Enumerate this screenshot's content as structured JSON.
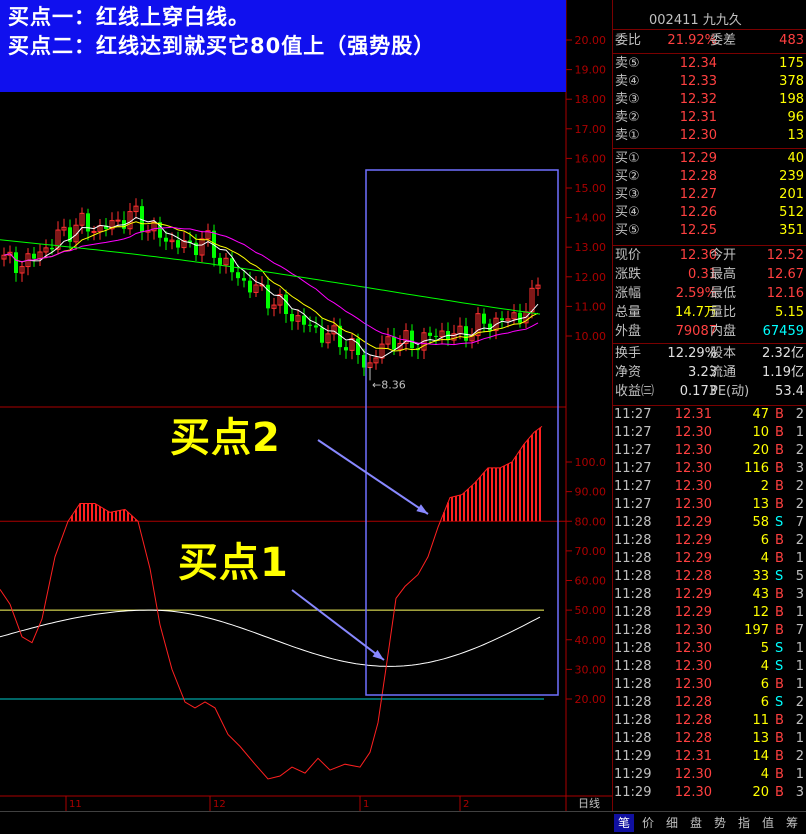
{
  "banner": {
    "line1": "买点一：红线上穿白线。",
    "line2": "买点二：红线达到就买它80值上（强势股）"
  },
  "callouts": {
    "buy2": "买点2",
    "buy1": "买点1"
  },
  "chart": {
    "low_marker": "8.36",
    "x_labels": [
      "11",
      "12",
      "1",
      "2"
    ],
    "period_label": "日线",
    "price_ticks": [
      "20.00",
      "19.00",
      "18.00",
      "17.00",
      "16.00",
      "15.00",
      "14.00",
      "13.00",
      "12.00",
      "11.00",
      "10.00"
    ],
    "ind_ticks": [
      "100.0",
      "90.00",
      "80.00",
      "70.00",
      "60.00",
      "50.00",
      "40.00",
      "30.00",
      "20.00"
    ],
    "colors": {
      "up": "#ff3030",
      "down": "#00ff00",
      "ma5": "#ffffff",
      "ma10": "#ffff00",
      "ma20": "#ff00ff",
      "ma60": "#00ff00",
      "axis": "#aa0000",
      "box": "#7070ff"
    }
  },
  "quote": {
    "stock_code": "002411",
    "stock_name": "九九久",
    "weibi_label": "委比",
    "weibi_value": "21.92%",
    "weicha_label": "委差",
    "weicha_value": "483",
    "asks": [
      {
        "label": "卖⑤",
        "price": "12.34",
        "vol": "175"
      },
      {
        "label": "卖④",
        "price": "12.33",
        "vol": "378"
      },
      {
        "label": "卖③",
        "price": "12.32",
        "vol": "198"
      },
      {
        "label": "卖②",
        "price": "12.31",
        "vol": "96"
      },
      {
        "label": "卖①",
        "price": "12.30",
        "vol": "13"
      }
    ],
    "bids": [
      {
        "label": "买①",
        "price": "12.29",
        "vol": "40"
      },
      {
        "label": "买②",
        "price": "12.28",
        "vol": "239"
      },
      {
        "label": "买③",
        "price": "12.27",
        "vol": "201"
      },
      {
        "label": "买④",
        "price": "12.26",
        "vol": "512"
      },
      {
        "label": "买⑤",
        "price": "12.25",
        "vol": "351"
      }
    ],
    "stats": [
      {
        "l1": "现价",
        "v1": "12.30",
        "l2": "今开",
        "v2": "12.52"
      },
      {
        "l1": "涨跌",
        "v1": "0.31",
        "l2": "最高",
        "v2": "12.67"
      },
      {
        "l1": "涨幅",
        "v1": "2.59%",
        "l2": "最低",
        "v2": "12.16"
      },
      {
        "l1": "总量",
        "v1": "14.7万",
        "l2": "量比",
        "v2": "5.15"
      },
      {
        "l1": "外盘",
        "v1": "79087",
        "l2": "内盘",
        "v2": "67459"
      }
    ],
    "stats2": [
      {
        "l1": "换手",
        "v1": "12.29%",
        "l2": "股本",
        "v2": "2.32亿"
      },
      {
        "l1": "净资",
        "v1": "3.23",
        "l2": "流通",
        "v2": "1.19亿"
      },
      {
        "l1": "收益㈢",
        "v1": "0.173",
        "l2": "PE(动)",
        "v2": "53.4"
      }
    ]
  },
  "ticks": [
    {
      "t": "11:27",
      "p": "12.31",
      "v": "47",
      "s": "B",
      "n": "2"
    },
    {
      "t": "11:27",
      "p": "12.30",
      "v": "10",
      "s": "B",
      "n": "1"
    },
    {
      "t": "11:27",
      "p": "12.30",
      "v": "20",
      "s": "B",
      "n": "2"
    },
    {
      "t": "11:27",
      "p": "12.30",
      "v": "116",
      "s": "B",
      "n": "3"
    },
    {
      "t": "11:27",
      "p": "12.30",
      "v": "2",
      "s": "B",
      "n": "2"
    },
    {
      "t": "11:27",
      "p": "12.30",
      "v": "13",
      "s": "B",
      "n": "2"
    },
    {
      "t": "11:28",
      "p": "12.29",
      "v": "58",
      "s": "S",
      "n": "7"
    },
    {
      "t": "11:28",
      "p": "12.29",
      "v": "6",
      "s": "B",
      "n": "2"
    },
    {
      "t": "11:28",
      "p": "12.29",
      "v": "4",
      "s": "B",
      "n": "1"
    },
    {
      "t": "11:28",
      "p": "12.28",
      "v": "33",
      "s": "S",
      "n": "5"
    },
    {
      "t": "11:28",
      "p": "12.29",
      "v": "43",
      "s": "B",
      "n": "3"
    },
    {
      "t": "11:28",
      "p": "12.29",
      "v": "12",
      "s": "B",
      "n": "1"
    },
    {
      "t": "11:28",
      "p": "12.30",
      "v": "197",
      "s": "B",
      "n": "7"
    },
    {
      "t": "11:28",
      "p": "12.30",
      "v": "5",
      "s": "S",
      "n": "1"
    },
    {
      "t": "11:28",
      "p": "12.30",
      "v": "4",
      "s": "S",
      "n": "1"
    },
    {
      "t": "11:28",
      "p": "12.30",
      "v": "6",
      "s": "B",
      "n": "1"
    },
    {
      "t": "11:28",
      "p": "12.28",
      "v": "6",
      "s": "S",
      "n": "2"
    },
    {
      "t": "11:28",
      "p": "12.28",
      "v": "11",
      "s": "B",
      "n": "2"
    },
    {
      "t": "11:28",
      "p": "12.28",
      "v": "13",
      "s": "B",
      "n": "1"
    },
    {
      "t": "11:29",
      "p": "12.31",
      "v": "14",
      "s": "B",
      "n": "2"
    },
    {
      "t": "11:29",
      "p": "12.30",
      "v": "4",
      "s": "B",
      "n": "1"
    },
    {
      "t": "11:29",
      "p": "12.30",
      "v": "20",
      "s": "B",
      "n": "3"
    }
  ],
  "tabs": [
    "笔",
    "价",
    "细",
    "盘",
    "势",
    "指",
    "值",
    "筹"
  ]
}
